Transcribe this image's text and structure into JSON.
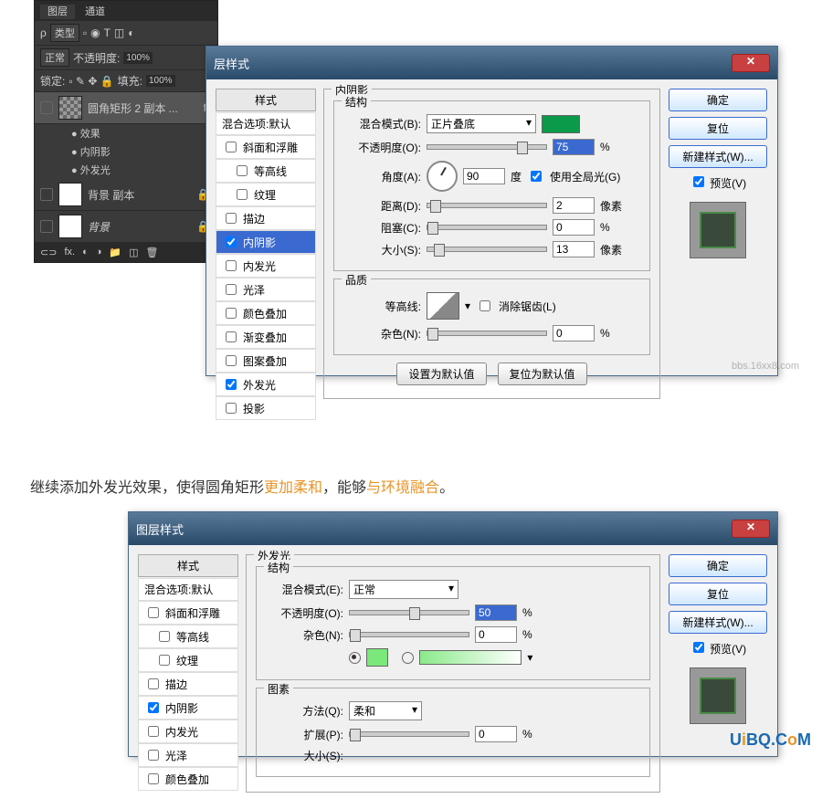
{
  "layersPanel": {
    "tabs": {
      "layers": "图层",
      "channels": "通道"
    },
    "kind": "类型",
    "blend": "正常",
    "opacityLabel": "不透明度:",
    "opacity": "100%",
    "lockLabel": "锁定:",
    "fillLabel": "填充:",
    "fill": "100%",
    "layer1": "圆角矩形 2 副本 ...",
    "fx": "fx",
    "effects": "效果",
    "innerShadow": "内阴影",
    "outerGlow": "外发光",
    "layer2": "背景 副本",
    "layer3": "背景"
  },
  "dialog1": {
    "title": "层样式",
    "styles": {
      "header": "样式",
      "blendDefault": "混合选项:默认",
      "bevel": "斜面和浮雕",
      "contour": "等高线",
      "texture": "纹理",
      "stroke": "描边",
      "innerShadow": "内阴影",
      "innerGlow": "内发光",
      "satin": "光泽",
      "colorOverlay": "颜色叠加",
      "gradientOverlay": "渐变叠加",
      "patternOverlay": "图案叠加",
      "outerGlow": "外发光",
      "dropShadow": "投影"
    },
    "section": "内阴影",
    "structure": "结构",
    "blendMode": {
      "label": "混合模式(B):",
      "value": "正片叠底"
    },
    "opacity": {
      "label": "不透明度(O):",
      "value": "75",
      "unit": "%"
    },
    "angle": {
      "label": "角度(A):",
      "value": "90",
      "unit": "度",
      "global": "使用全局光(G)"
    },
    "distance": {
      "label": "距离(D):",
      "value": "2",
      "unit": "像素"
    },
    "choke": {
      "label": "阻塞(C):",
      "value": "0",
      "unit": "%"
    },
    "size": {
      "label": "大小(S):",
      "value": "13",
      "unit": "像素"
    },
    "quality": "品质",
    "contourLabel": "等高线:",
    "antiAlias": "消除锯齿(L)",
    "noise": {
      "label": "杂色(N):",
      "value": "0",
      "unit": "%"
    },
    "setDefault": "设置为默认值",
    "resetDefault": "复位为默认值",
    "ok": "确定",
    "cancel": "复位",
    "newStyle": "新建样式(W)...",
    "preview": "预览(V)",
    "swatchColor": "#0a9a4a"
  },
  "caption": {
    "p1": "继续添加外发光效果，使得圆角矩形",
    "hl1": "更加柔和",
    "p2": "，能够",
    "hl2": "与环境融合",
    "p3": "。"
  },
  "dialog2": {
    "title": "图层样式",
    "styles": {
      "header": "样式",
      "blendDefault": "混合选项:默认",
      "bevel": "斜面和浮雕",
      "contour": "等高线",
      "texture": "纹理",
      "stroke": "描边",
      "innerShadow": "内阴影",
      "innerGlow": "内发光",
      "satin": "光泽",
      "colorOverlay": "颜色叠加"
    },
    "section": "外发光",
    "structure": "结构",
    "blendMode": {
      "label": "混合模式(E):",
      "value": "正常"
    },
    "opacity": {
      "label": "不透明度(O):",
      "value": "50",
      "unit": "%"
    },
    "noise": {
      "label": "杂色(N):",
      "value": "0",
      "unit": "%"
    },
    "element": "图素",
    "method": {
      "label": "方法(Q):",
      "value": "柔和"
    },
    "spread": {
      "label": "扩展(P):",
      "value": "0",
      "unit": "%"
    },
    "size": {
      "label": "大小(S):"
    },
    "ok": "确定",
    "cancel": "复位",
    "newStyle": "新建样式(W)...",
    "preview": "预览(V)",
    "swatchColor": "#7ae87a"
  },
  "watermark1": "bbs.16xx8.com",
  "watermark2": {
    "u": "U",
    "i": "i",
    "b": "B",
    "q": "Q",
    ".": ".",
    "c": "C",
    "o": "o",
    "m": "M"
  }
}
